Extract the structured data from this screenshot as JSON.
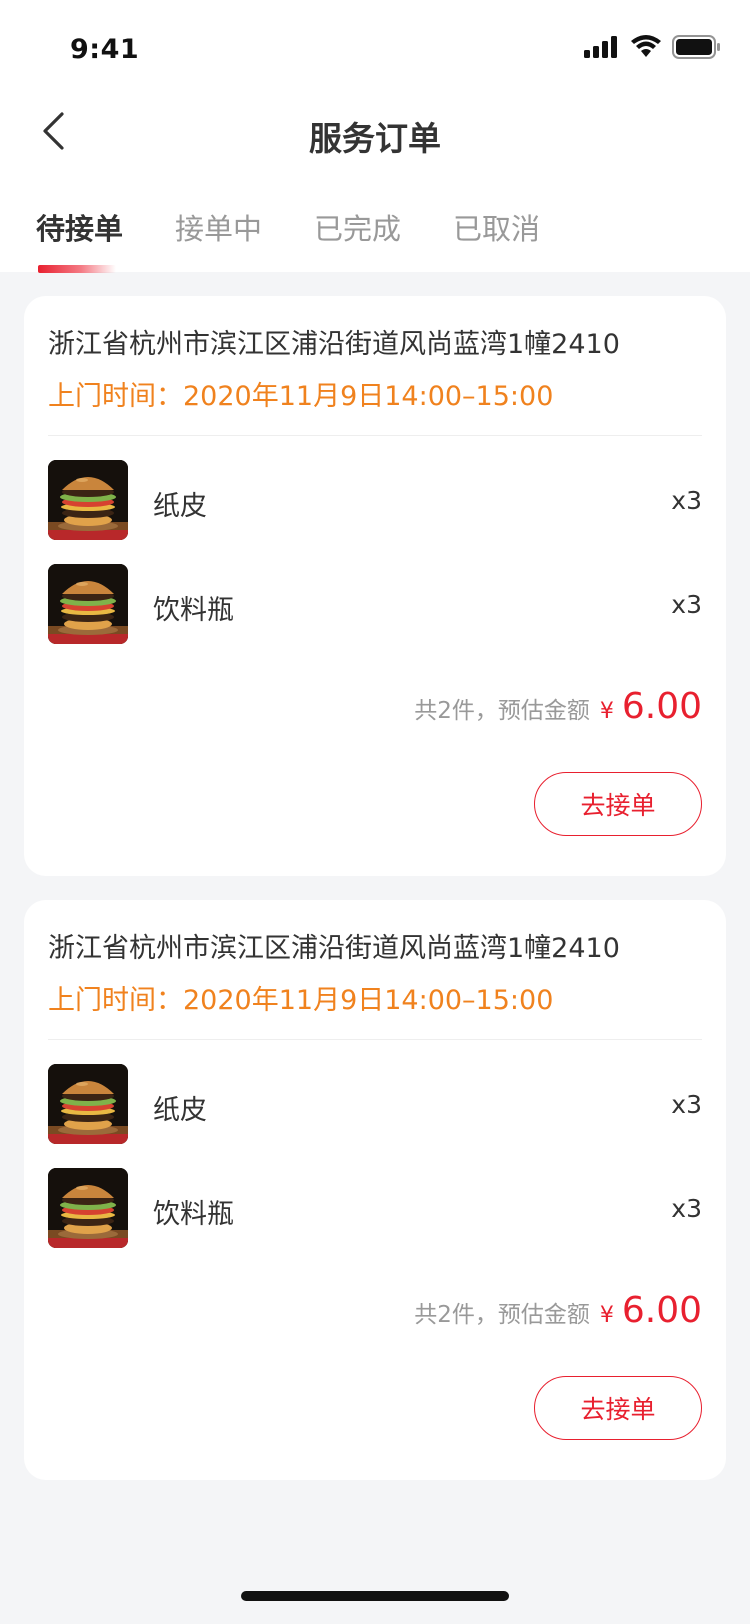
{
  "status_bar": {
    "time": "9:41"
  },
  "nav": {
    "title": "服务订单",
    "back_icon": "chevron-left-icon"
  },
  "tabs": [
    {
      "label": "待接单",
      "active": true
    },
    {
      "label": "接单中",
      "active": false
    },
    {
      "label": "已完成",
      "active": false
    },
    {
      "label": "已取消",
      "active": false
    }
  ],
  "orders": [
    {
      "address": "浙江省杭州市滨江区浦沿街道风尚蓝湾1幢2410",
      "visit_time": "上门时间：2020年11月9日14:00–15:00",
      "items": [
        {
          "name": "纸皮",
          "qty": "x3",
          "image": "burger-photo"
        },
        {
          "name": "饮料瓶",
          "qty": "x3",
          "image": "burger-photo"
        }
      ],
      "summary_text": "共2件，预估金额",
      "currency": "¥",
      "amount": "6.00",
      "action_label": "去接单"
    },
    {
      "address": "浙江省杭州市滨江区浦沿街道风尚蓝湾1幢2410",
      "visit_time": "上门时间：2020年11月9日14:00–15:00",
      "items": [
        {
          "name": "纸皮",
          "qty": "x3",
          "image": "burger-photo"
        },
        {
          "name": "饮料瓶",
          "qty": "x3",
          "image": "burger-photo"
        }
      ],
      "summary_text": "共2件，预估金额",
      "currency": "¥",
      "amount": "6.00",
      "action_label": "去接单"
    }
  ],
  "colors": {
    "accent": "#e8202f",
    "visit_time": "#f0821e",
    "background": "#f4f5f7"
  }
}
